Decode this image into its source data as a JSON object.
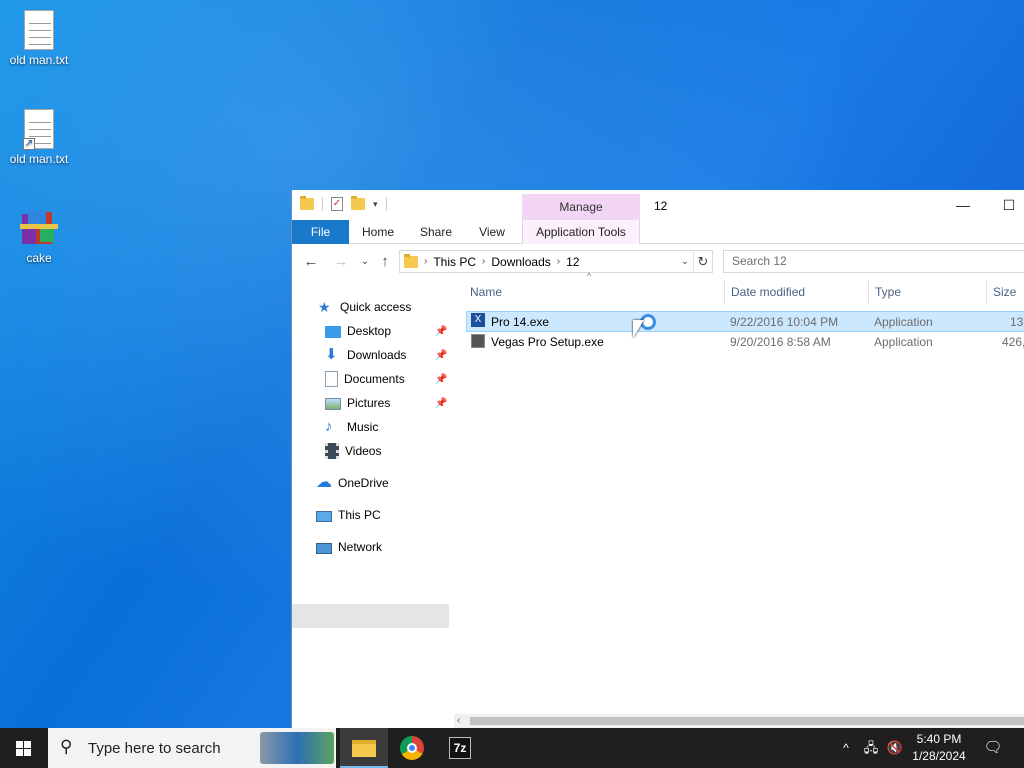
{
  "desktop": {
    "icons": [
      {
        "label": "old man.txt",
        "icon": "text-file-icon"
      },
      {
        "label": "old man.txt",
        "icon": "text-file-shortcut-icon"
      },
      {
        "label": "cake",
        "icon": "winrar-box-icon"
      }
    ]
  },
  "window": {
    "title": "12",
    "contextual_tab": "Manage",
    "tabs": [
      "File",
      "Home",
      "Share",
      "View",
      "Application Tools"
    ],
    "address": {
      "segments": [
        "This PC",
        "Downloads",
        "12"
      ]
    },
    "search_placeholder": "Search 12",
    "nav": {
      "quick_access": "Quick access",
      "items": [
        "Desktop",
        "Downloads",
        "Documents",
        "Pictures",
        "Music",
        "Videos"
      ],
      "onedrive": "OneDrive",
      "this_pc": "This PC",
      "network": "Network"
    },
    "columns": [
      "Name",
      "Date modified",
      "Type",
      "Size"
    ],
    "files": [
      {
        "name": "Pro 14.exe",
        "date": "9/22/2016 10:04 PM",
        "type": "Application",
        "size": "13,",
        "selected": true
      },
      {
        "name": "Vegas Pro Setup.exe",
        "date": "9/20/2016 8:58 AM",
        "type": "Application",
        "size": "426,",
        "selected": false
      }
    ]
  },
  "taskbar": {
    "search_placeholder": "Type here to search",
    "clock_time": "5:40 PM",
    "clock_date": "1/28/2024"
  },
  "colors": {
    "ribbon_file_tab": "#1979ca",
    "manage_tab": "#f3d5f6",
    "selection": "#cce8ff"
  }
}
